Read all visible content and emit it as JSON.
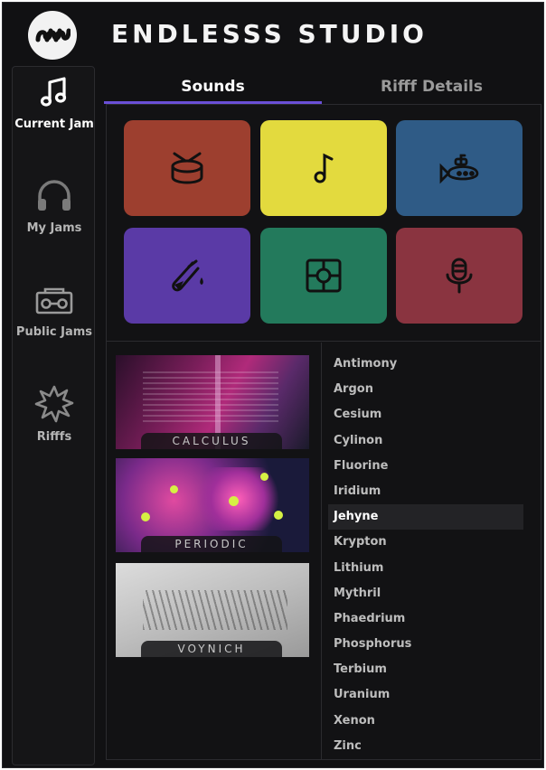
{
  "app": {
    "title": "ENDLESSS STUDIO"
  },
  "sidebar": {
    "items": [
      {
        "label": "Current Jam",
        "icon": "music-note-icon"
      },
      {
        "label": "My Jams",
        "icon": "headphones-icon"
      },
      {
        "label": "Public Jams",
        "icon": "boombox-icon"
      },
      {
        "label": "Rifffs",
        "icon": "burst-icon"
      }
    ],
    "active_index": 0
  },
  "tabs": [
    {
      "label": "Sounds",
      "active": true
    },
    {
      "label": "Rifff Details",
      "active": false
    }
  ],
  "pads": [
    {
      "icon": "drum-icon",
      "color": "#9d3f2f"
    },
    {
      "icon": "music-note-icon",
      "color": "#e3da3e"
    },
    {
      "icon": "submarine-icon",
      "color": "#2f5b86"
    },
    {
      "icon": "test-tube-icon",
      "color": "#5a3aa6"
    },
    {
      "icon": "mixer-box-icon",
      "color": "#237a5c"
    },
    {
      "icon": "microphone-icon",
      "color": "#8a3440"
    }
  ],
  "packs": [
    {
      "label": "CALCULUS"
    },
    {
      "label": "PERIODIC"
    },
    {
      "label": "VOYNICH"
    }
  ],
  "sounds": {
    "items": [
      "Antimony",
      "Argon",
      "Cesium",
      "Cylinon",
      "Fluorine",
      "Iridium",
      "Jehyne",
      "Krypton",
      "Lithium",
      "Mythril",
      "Phaedrium",
      "Phosphorus",
      "Terbium",
      "Uranium",
      "Xenon",
      "Zinc"
    ],
    "selected": "Jehyne"
  }
}
